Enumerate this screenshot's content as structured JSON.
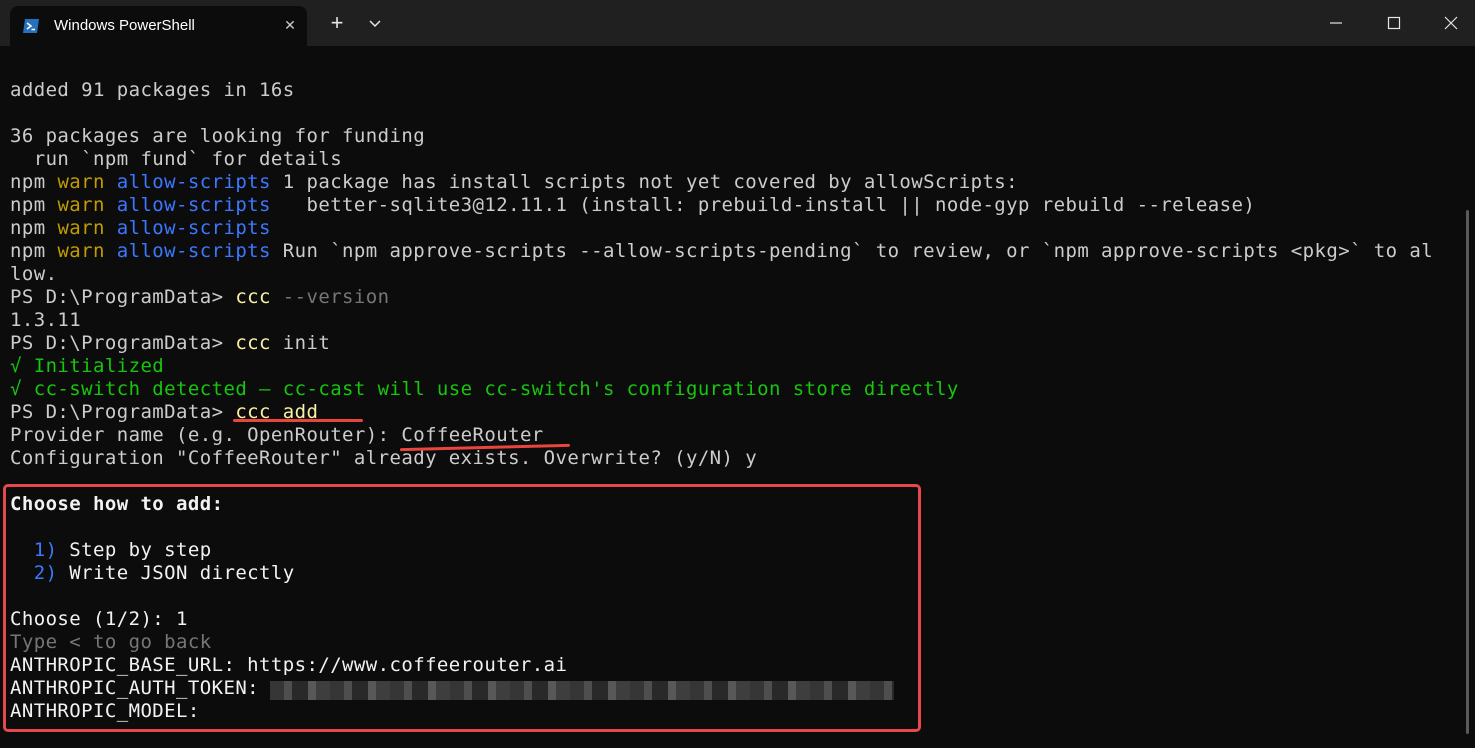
{
  "window": {
    "tab_title": "Windows PowerShell",
    "tab_close": "✕",
    "new_tab": "+",
    "icons": [
      "powershell-icon",
      "chevron-down-icon",
      "minimize-icon",
      "maximize-icon",
      "close-icon"
    ]
  },
  "terminal": {
    "colors": {
      "background": "#0c0c0c",
      "text": "#cccccc",
      "warn": "#c19c00",
      "scope": "#3b78ff",
      "command": "#f9f1a5",
      "parameter": "#767676",
      "success": "#16c60c",
      "annotation": "#e5484d"
    },
    "lines": {
      "l1": "added 91 packages in 16s",
      "l2": "36 packages are looking for funding",
      "l3": "  run `npm fund` for details",
      "npm": "npm",
      "warn": "warn",
      "scope": "allow-scripts",
      "w1": " 1 package has install scripts not yet covered by allowScripts:",
      "w2": "   better-sqlite3@12.11.1 (install: prebuild-install || node-gyp rebuild --release)",
      "w4": " Run `npm approve-scripts --allow-scripts-pending` to review, or `npm approve-scripts <pkg>` to al",
      "w4b": "low.",
      "prompt": "PS D:\\ProgramData> ",
      "ccc": "ccc",
      "version_flag": " --version",
      "version_out": "1.3.11",
      "init_arg": " init",
      "init_ok": "√ Initialized",
      "ccswitch_ok": "√ cc-switch detected — cc-cast will use cc-switch's configuration store directly",
      "add_cmd": "ccc add",
      "provider_prompt": "Provider name (e.g. OpenRouter): ",
      "provider_value": "CoffeeRouter",
      "overwrite": "Configuration \"CoffeeRouter\" already exists. Overwrite? (y/N) y",
      "choose_how": "Choose how to add:",
      "opt1_num": "  1)",
      "opt1_label": " Step by step",
      "opt2_num": "  2)",
      "opt2_label": " Write JSON directly",
      "choose_prompt": "Choose (1/2): 1",
      "back_hint": "Type < to go back",
      "base_url": "ANTHROPIC_BASE_URL: https://www.coffeerouter.ai",
      "auth_token": "ANTHROPIC_AUTH_TOKEN: ",
      "model": "ANTHROPIC_MODEL:"
    }
  }
}
